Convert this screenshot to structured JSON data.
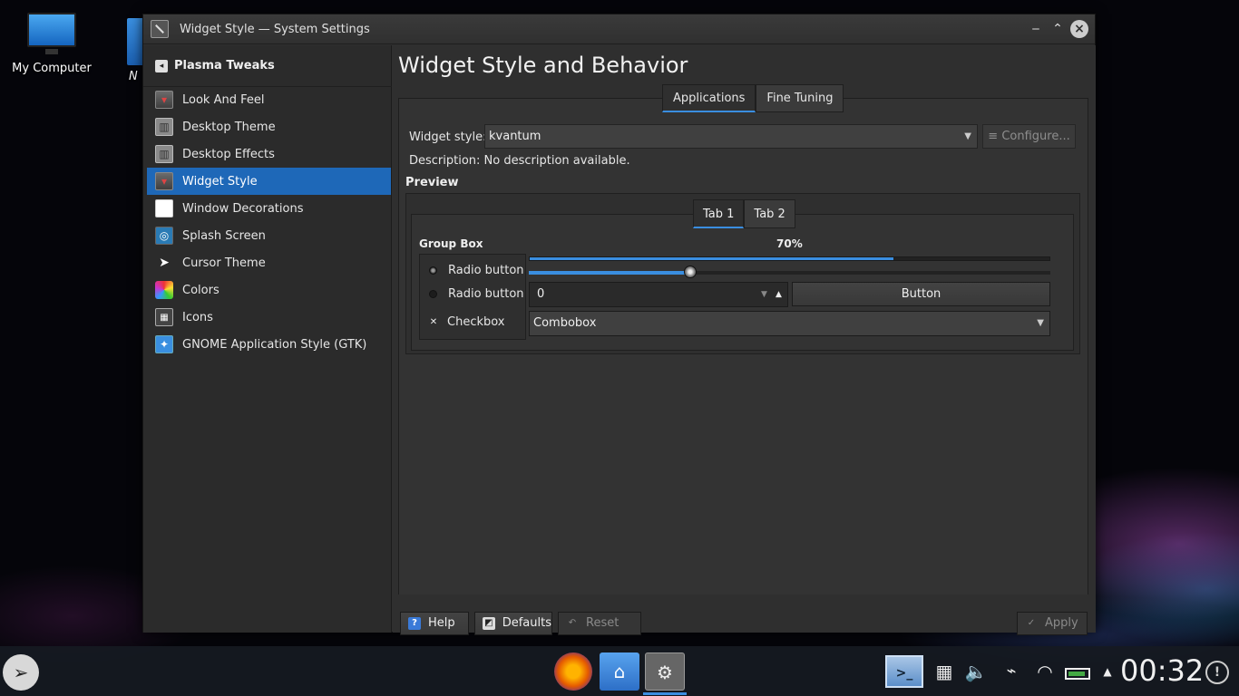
{
  "desktop": {
    "icons": [
      {
        "label": "My Computer",
        "icon": "computer-icon"
      },
      {
        "label": "N",
        "icon": "folder-icon"
      }
    ]
  },
  "window": {
    "title": "Widget Style — System Settings",
    "controls": {
      "minimize": "‒",
      "maximize": "⌃",
      "close": "×"
    }
  },
  "sidebar": {
    "title": "Plasma Tweaks",
    "back_icon": "◂",
    "items": [
      {
        "label": "Look And Feel",
        "icon": "look-and-feel-icon",
        "glyph": "▾"
      },
      {
        "label": "Desktop Theme",
        "icon": "desktop-theme-icon",
        "glyph": "▥"
      },
      {
        "label": "Desktop Effects",
        "icon": "desktop-effects-icon",
        "glyph": "▥"
      },
      {
        "label": "Widget Style",
        "icon": "widget-style-icon",
        "glyph": "▾",
        "selected": true
      },
      {
        "label": "Window Decorations",
        "icon": "window-decorations-icon",
        "glyph": ""
      },
      {
        "label": "Splash Screen",
        "icon": "splash-screen-icon",
        "glyph": "◎"
      },
      {
        "label": "Cursor Theme",
        "icon": "cursor-icon",
        "glyph": "➤"
      },
      {
        "label": "Colors",
        "icon": "colors-icon",
        "glyph": ""
      },
      {
        "label": "Icons",
        "icon": "icons-icon",
        "glyph": "▦"
      },
      {
        "label": "GNOME Application Style (GTK)",
        "icon": "gtk-icon",
        "glyph": "✦"
      }
    ]
  },
  "main": {
    "title": "Widget Style and Behavior",
    "tabs": [
      {
        "label": "Applications",
        "active": true
      },
      {
        "label": "Fine Tuning",
        "active": false
      }
    ],
    "widget_style_label": "Widget style:",
    "widget_style_value": "kvantum",
    "configure_label": "Configure...",
    "configure_icon": "≡",
    "description": "Description: No description available.",
    "preview_label": "Preview",
    "preview": {
      "tabs": [
        {
          "label": "Tab 1",
          "active": true
        },
        {
          "label": "Tab 2",
          "active": false
        }
      ],
      "group_box_label": "Group Box",
      "radio_1": "Radio button",
      "radio_2": "Radio button",
      "checkbox": "Checkbox",
      "checkbox_mark": "✕",
      "progress_label": "70%",
      "progress_value": 0.7,
      "slider_value": 0.31,
      "spinbox_value": "0",
      "button_label": "Button",
      "combobox_value": "Combobox"
    },
    "buttons": {
      "help": "Help",
      "help_glyph": "?",
      "defaults": "Defaults",
      "defaults_glyph": "◩",
      "reset": "Reset",
      "reset_glyph": "↶",
      "apply": "Apply",
      "apply_glyph": "✓"
    }
  },
  "taskbar": {
    "launcher_glyph": "➢",
    "apps": [
      {
        "name": "Firefox",
        "icon": "firefox-icon"
      },
      {
        "name": "Files",
        "icon": "home-folder-icon",
        "glyph": "⌂"
      },
      {
        "name": "System Settings",
        "icon": "system-settings-icon",
        "glyph": "⚙",
        "active": true
      }
    ],
    "tray": {
      "terminal_glyph": ">_",
      "calc_glyph": "▦",
      "volume_glyph": "🔈",
      "usb_glyph": "⌁",
      "wifi_glyph": "◠",
      "expand_glyph": "▲",
      "notify_glyph": "!"
    },
    "clock": "00:32"
  },
  "colors": {
    "accent": "#1e68b8",
    "highlight": "#3a8ee0"
  }
}
